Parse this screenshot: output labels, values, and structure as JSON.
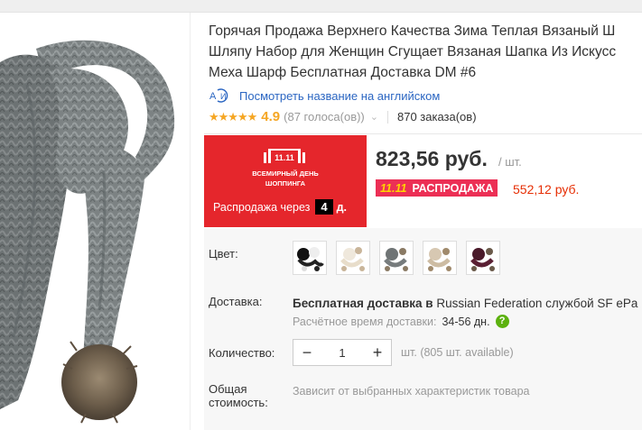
{
  "product": {
    "title": "Горячая Продажа Верхнего Качества Зима Теплая Вязаный Ш\nШляпу Набор для Женщин Сгущает Вязаная Шапка Из Искусс\nМеха Шарф Бесплатная Доставка DM #6",
    "translate_link": "Посмотреть название на английском",
    "rating_stars": "★★★★★",
    "rating_value": "4.9",
    "votes": "(87 голоса(ов))",
    "orders": "870 заказа(ов)"
  },
  "promo": {
    "logo_text": "11.11",
    "line1": "ВСЕМИРНЫЙ ДЕНЬ",
    "line2": "ШОППИНГА",
    "countdown_label": "Распродажа через",
    "days": "4",
    "days_unit": "д."
  },
  "price": {
    "main": "823,56 руб.",
    "unit": "/ шт.",
    "sale_badge_num": "11.11",
    "sale_badge_text": "РАСПРОДАЖА",
    "sale_price": "552,12 руб."
  },
  "options": {
    "color_label": "Цвет:",
    "swatches": [
      "black-white",
      "cream",
      "gray",
      "beige",
      "burgundy"
    ],
    "shipping_label": "Доставка:",
    "shipping_bold": "Бесплатная доставка в",
    "shipping_rest": " Russian Federation службой SF ePa",
    "delivery_time_label": "Расчётное время доставки:",
    "delivery_time_value": "34-56 дн.",
    "help_icon": "?",
    "qty_label": "Количество:",
    "qty_minus": "−",
    "qty_value": "1",
    "qty_plus": "+",
    "qty_info": "шт. (805 шт. available)",
    "total_label_1": "Общая",
    "total_label_2": "стоимость:",
    "total_note": "Зависит от выбранных характеристик товара"
  },
  "colors": {
    "promo_red": "#e5262c",
    "sale_pink": "#ec2f55",
    "link_blue": "#2b66c2",
    "star_orange": "#f5a623",
    "help_green": "#5cb10f"
  }
}
